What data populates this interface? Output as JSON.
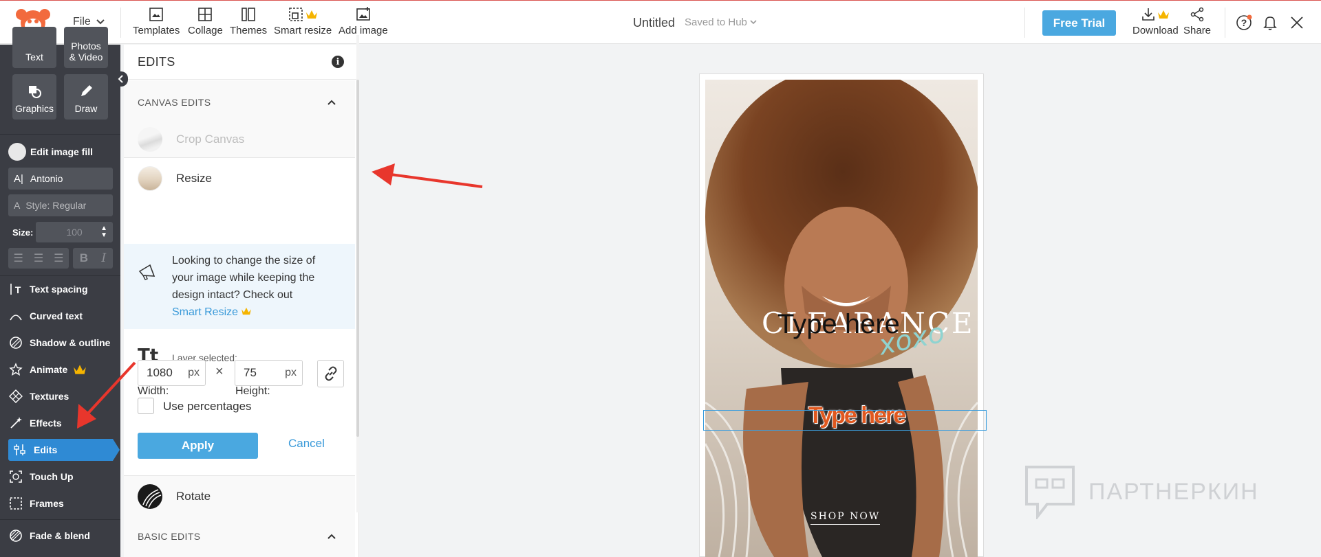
{
  "topbar": {
    "file_label": "File",
    "tools": [
      {
        "label": "Templates"
      },
      {
        "label": "Collage"
      },
      {
        "label": "Themes"
      },
      {
        "label": "Smart resize"
      },
      {
        "label": "Add image"
      }
    ],
    "doc_title": "Untitled",
    "saved_status": "Saved to Hub",
    "free_trial_label": "Free Trial",
    "download_label": "Download",
    "share_label": "Share",
    "accent_color": "#4aa8e0"
  },
  "sidebar": {
    "tiles": [
      {
        "label": "Text"
      },
      {
        "label": "Photos\n& Video"
      },
      {
        "label": "Graphics"
      },
      {
        "label": "Draw"
      }
    ],
    "edit_fill_label": "Edit image fill",
    "font_name": "Antonio",
    "font_style": "Style: Regular",
    "size_label": "Size:",
    "size_value": "100",
    "bold_label": "B",
    "italic_label": "I",
    "tools": [
      {
        "label": "Text spacing"
      },
      {
        "label": "Curved text"
      },
      {
        "label": "Shadow & outline"
      },
      {
        "label": "Animate"
      },
      {
        "label": "Textures"
      },
      {
        "label": "Effects"
      },
      {
        "label": "Edits"
      },
      {
        "label": "Touch Up"
      },
      {
        "label": "Frames"
      },
      {
        "label": "Fade & blend"
      }
    ],
    "active_tool": "Edits"
  },
  "edits": {
    "title": "EDITS",
    "canvas_section": "CANVAS EDITS",
    "crop_label": "Crop Canvas",
    "resize_label": "Resize",
    "info_text": "Looking to change the size of your image while keeping the design intact? Check out",
    "smart_resize_link": "Smart Resize",
    "tt_icon": "Tt",
    "layer_selected": "Layer selected:",
    "width_label": "Width:",
    "height_label": "Height:",
    "width_value": "1080",
    "height_value": "75",
    "unit": "px",
    "times": "×",
    "use_percentages": "Use percentages",
    "apply_label": "Apply",
    "cancel_label": "Cancel",
    "rotate_label": "Rotate",
    "basic_section": "BASIC EDITS"
  },
  "canvas": {
    "text_clearance": "CLEARANCE",
    "text_overlay": "Type here",
    "text_xoxo": "xoxo",
    "text_typehere_orange": "Type here",
    "text_shop": "SHOP NOW"
  },
  "watermark": {
    "text": "ПАРТНЕРКИН"
  }
}
